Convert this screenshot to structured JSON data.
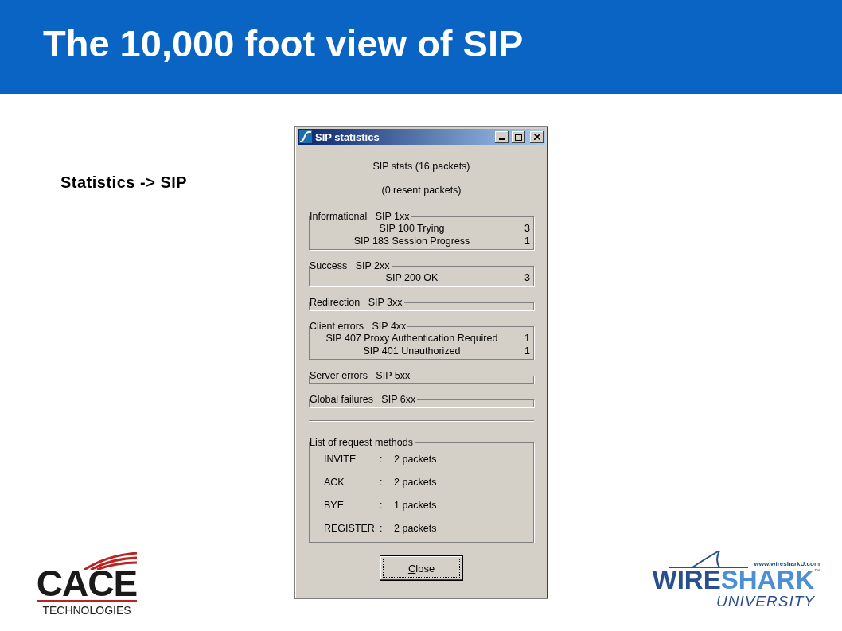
{
  "slide": {
    "title": "The 10,000 foot view of SIP",
    "caption": "Statistics -> SIP"
  },
  "window": {
    "title": "SIP statistics",
    "summary": [
      "SIP stats (16 packets)",
      "(0 resent packets)"
    ],
    "groups": [
      {
        "name": "Informational",
        "code": "SIP 1xx",
        "rows": [
          {
            "label": "SIP 100 Trying",
            "count": "3"
          },
          {
            "label": "SIP 183 Session Progress",
            "count": "1"
          }
        ]
      },
      {
        "name": "Success",
        "code": "SIP 2xx",
        "rows": [
          {
            "label": "SIP 200 OK",
            "count": "3"
          }
        ]
      },
      {
        "name": "Redirection",
        "code": "SIP 3xx"
      },
      {
        "name": "Client errors",
        "code": "SIP 4xx",
        "rows": [
          {
            "label": "SIP 407 Proxy Authentication Required",
            "count": "1"
          },
          {
            "label": "SIP 401 Unauthorized",
            "count": "1"
          }
        ]
      },
      {
        "name": "Server errors",
        "code": "SIP 5xx"
      },
      {
        "name": "Global failures",
        "code": "SIP 6xx"
      }
    ],
    "methods": {
      "legend": "List of request methods",
      "rows": [
        {
          "method": "INVITE",
          "separator": ":",
          "packets": "2 packets"
        },
        {
          "method": "ACK",
          "separator": ":",
          "packets": "2 packets"
        },
        {
          "method": "BYE",
          "separator": ":",
          "packets": "1 packets"
        },
        {
          "method": "REGISTER",
          "separator": ":",
          "packets": "2 packets"
        }
      ]
    },
    "close_button": "Close"
  },
  "logos": {
    "left": {
      "name": "CACE",
      "sub": "TECHNOLOGIES"
    },
    "right": {
      "url": "www.wiresharkU.com",
      "name_a": "WIRE",
      "name_b": "SHARK",
      "tm": "™",
      "sub": "UNIVERSITY"
    }
  }
}
